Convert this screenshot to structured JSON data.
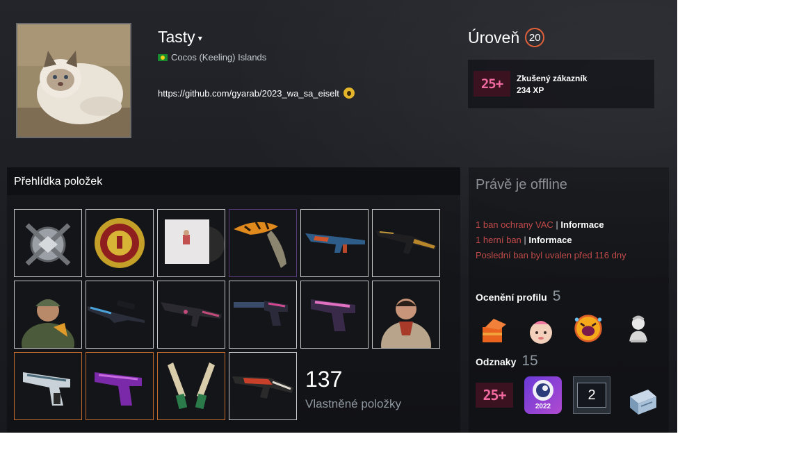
{
  "profile": {
    "persona_name": "Tasty",
    "caret": "▾",
    "location": "Cocos (Keeling) Islands",
    "summary": "https://github.com/gyarab/2023_wa_sa_eiselt"
  },
  "level": {
    "label": "Úroveň",
    "value": "20",
    "xp_badge": "25+",
    "xp_title": "Zkušený zákazník",
    "xp_value": "234 XP"
  },
  "showcase": {
    "title": "Přehlídka položek",
    "count": "137",
    "count_label": "Vlastněné položky",
    "items": [
      "silver-medal-icon",
      "coin-medal-icon",
      "music-kit-icon",
      "knife-icon",
      "rifle-blue-icon",
      "rifle-ak-icon",
      "agent-soldier-icon",
      "sniper-icon",
      "rifle-m4-icon",
      "pistol-silenced-icon",
      "pistol-pink-icon",
      "agent-man-icon",
      "deagle-icon",
      "pistol-purple-icon",
      "dual-pistols-icon",
      "rifle-red-icon"
    ]
  },
  "sidebar": {
    "status": "Právě je offline",
    "ban1": "1 ban ochrany VAC",
    "ban1_link": "Informace",
    "ban2": "1 herní ban",
    "ban2_link": "Informace",
    "ban_last": "Poslední ban byl uvalen před 116 dny",
    "sep": "|",
    "awards_title": "Ocenění profilu",
    "awards_count": "5",
    "badges_title": "Odznaky",
    "badges_count": "15",
    "badge_years": "25+",
    "badge_2022": "2022",
    "badge_number": "2"
  },
  "colors": {
    "accent_level": "#e0603a",
    "ban_red": "#c14a4a",
    "muted": "#8f98a0"
  }
}
